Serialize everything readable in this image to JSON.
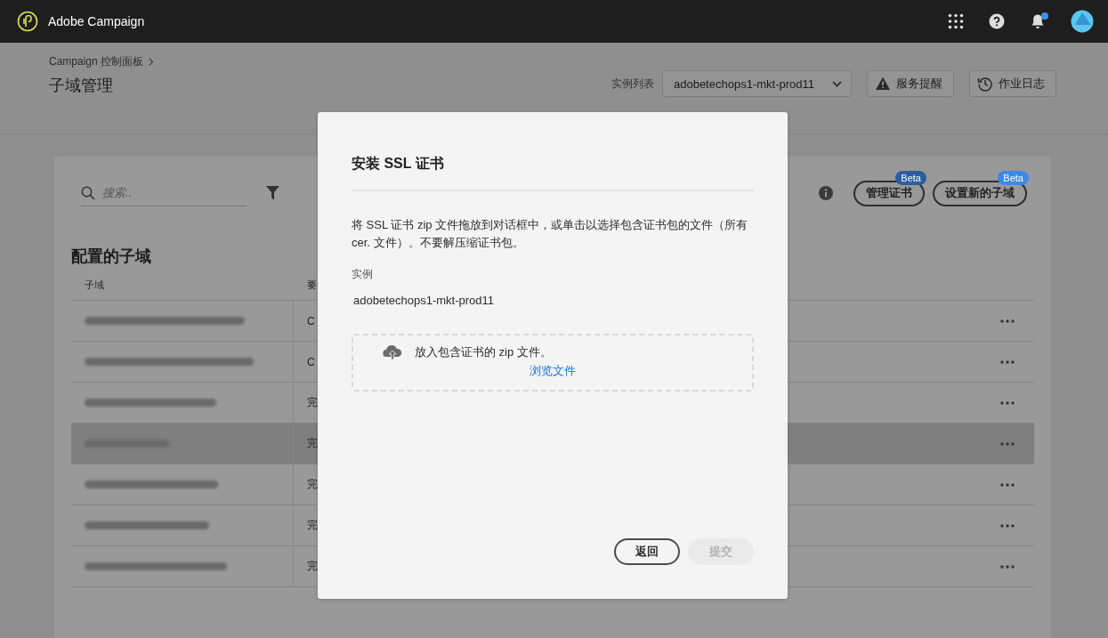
{
  "top_bar": {
    "app_name": "Adobe Campaign",
    "notifications_unread": true
  },
  "breadcrumb": [
    "Campaign 控制面板"
  ],
  "page_title": "子域管理",
  "instance_picker": {
    "label": "实例列表",
    "value": "adobetechops1-mkt-prod11"
  },
  "header_buttons": [
    {
      "kind": "alert",
      "label": "服务提醒"
    },
    {
      "kind": "history",
      "label": "作业日志"
    }
  ],
  "search": {
    "placeholder": "搜索.."
  },
  "card_buttons": [
    {
      "label": "管理证书",
      "badge": "Beta",
      "color": "#2c5da0"
    },
    {
      "label": "设置新的子域",
      "badge": "Beta",
      "color": "#3b8ae6"
    }
  ],
  "section_title": "配置的子域",
  "table": {
    "columns": [
      "子域",
      "要"
    ],
    "rows": [
      {
        "column_2": "C",
        "selected": false
      },
      {
        "column_2": "C",
        "selected": false
      },
      {
        "column_2": "完",
        "selected": false
      },
      {
        "column_2": "完",
        "selected": true
      },
      {
        "column_2": "完",
        "selected": false
      },
      {
        "column_2": "完",
        "selected": false
      },
      {
        "column_2": "完",
        "selected": false
      }
    ]
  },
  "dialog": {
    "title": "安装 SSL 证书",
    "description": "将 SSL 证书 zip 文件拖放到对话框中，或单击以选择包含证书包的文件（所有 cer. 文件）。不要解压缩证书包。",
    "instance_label": "实例",
    "instance_value": "adobetechops1-mkt-prod11",
    "dropzone_text": "放入包含证书的 zip 文件。",
    "browse_link": "浏览文件",
    "buttons": [
      {
        "label": "返回",
        "disabled": false
      },
      {
        "label": "提交",
        "disabled": true
      }
    ]
  }
}
